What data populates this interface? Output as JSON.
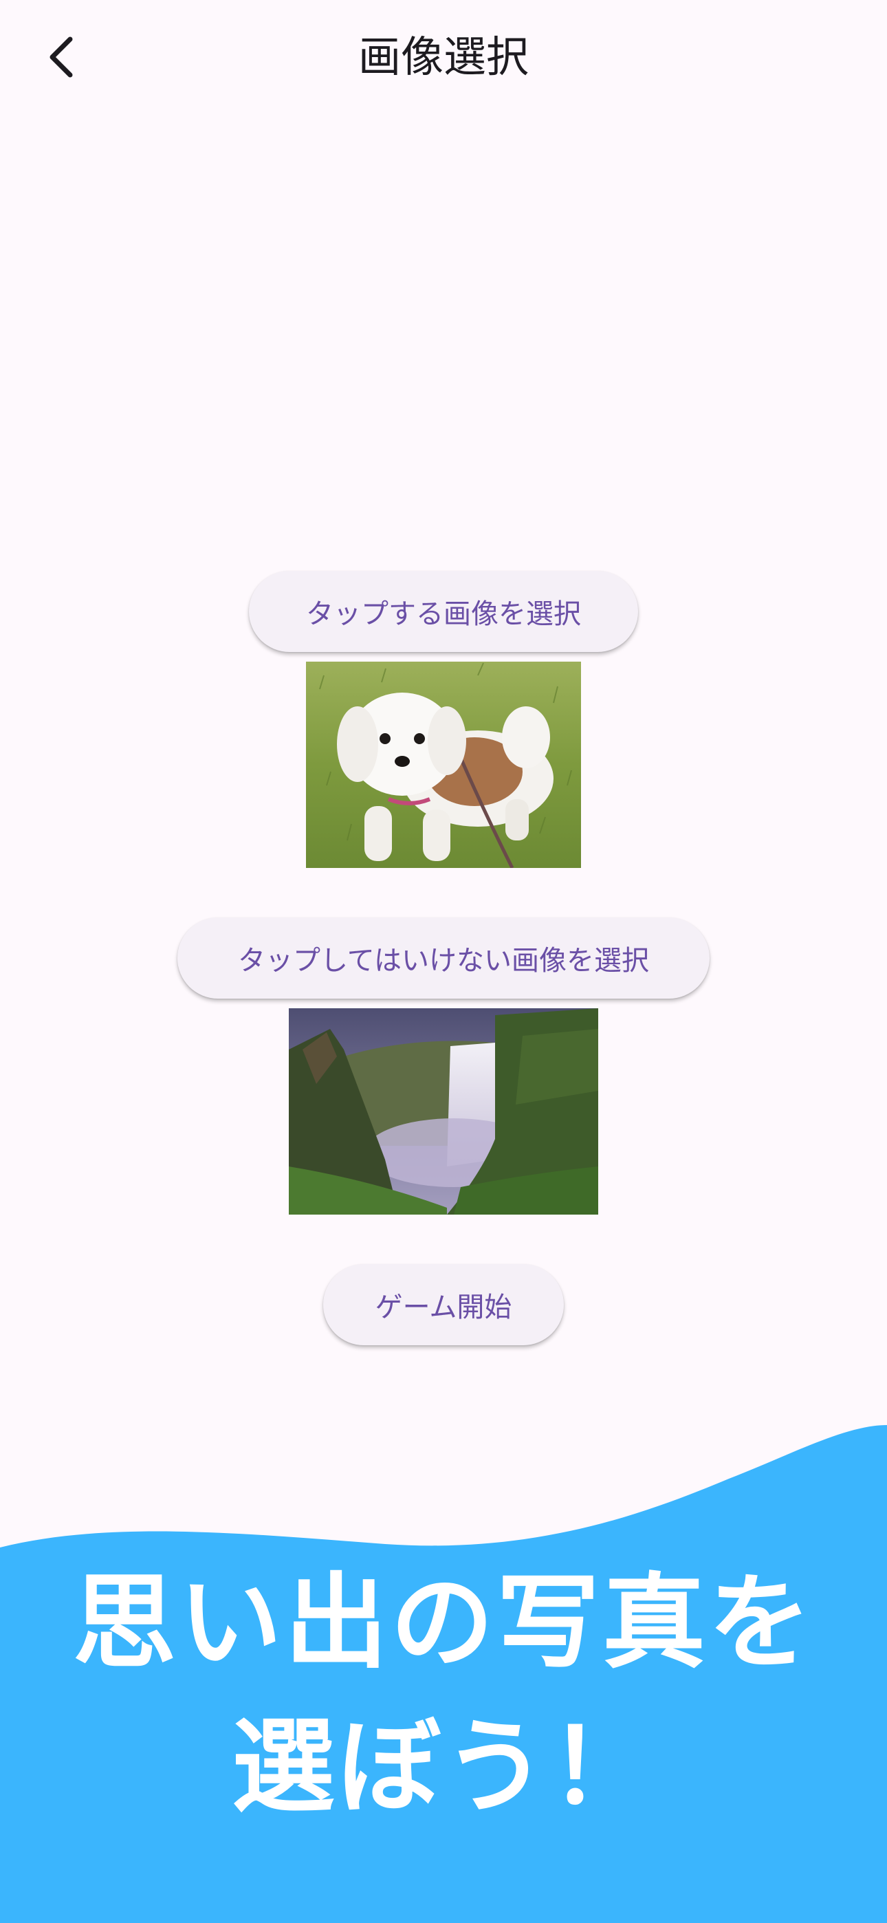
{
  "app_bar": {
    "title": "画像選択",
    "back_icon": "chevron-left-icon"
  },
  "buttons": {
    "tap_image": "タップする画像を選択",
    "no_tap_image": "タップしてはいけない画像を選択",
    "start_game": "ゲーム開始"
  },
  "promo": {
    "line1": "思い出の写真を",
    "line2": "選ぼう！"
  },
  "colors": {
    "background": "#FEF9FD",
    "button_bg": "#F5F0F7",
    "button_text": "#6A4FA6",
    "title_text": "#1D1B20",
    "promo_bg": "#3BB5FD",
    "promo_text": "#FFFFFF"
  }
}
